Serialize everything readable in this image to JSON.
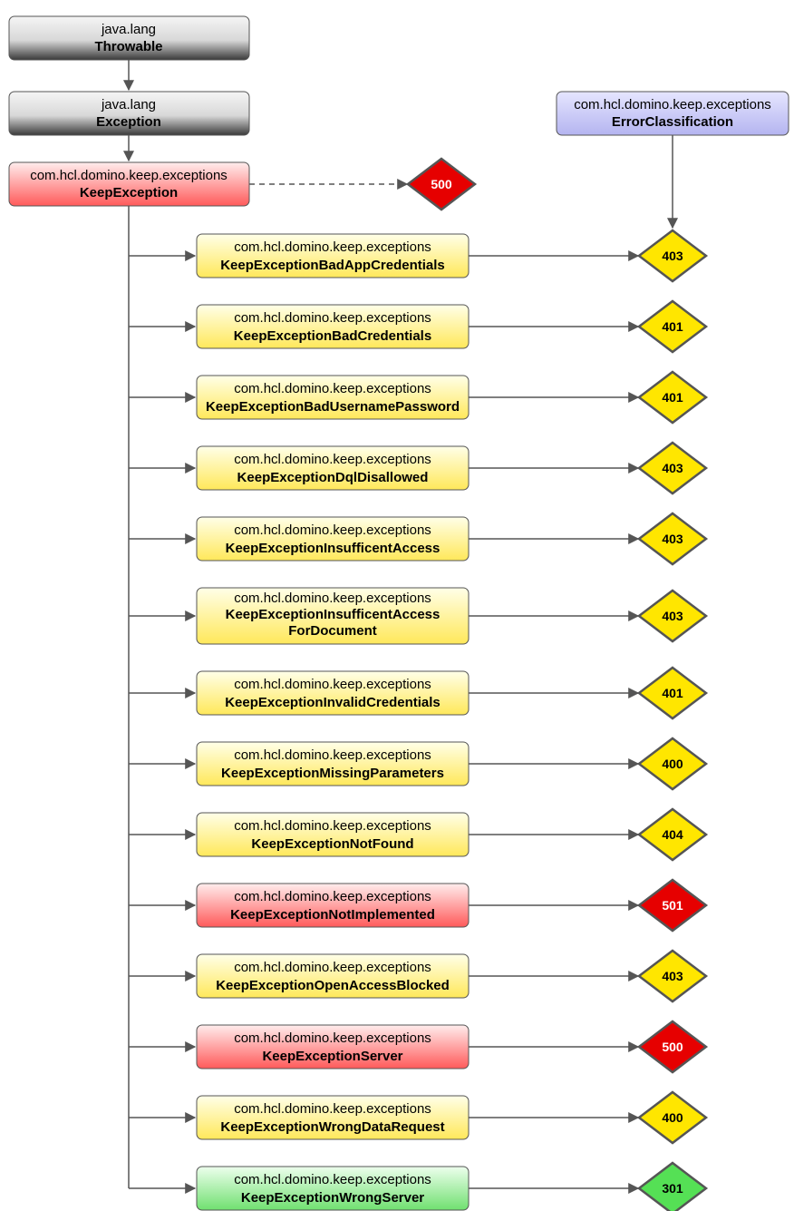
{
  "throwable": {
    "package": "java.lang",
    "name": "Throwable"
  },
  "exception": {
    "package": "java.lang",
    "name": "Exception"
  },
  "keepException": {
    "package": "com.hcl.domino.keep.exceptions",
    "name": "KeepException"
  },
  "errorClassification": {
    "package": "com.hcl.domino.keep.exceptions",
    "name": "ErrorClassification"
  },
  "keepExceptionCode": "500",
  "children": [
    {
      "package": "com.hcl.domino.keep.exceptions",
      "name": "KeepExceptionBadAppCredentials",
      "code": "403",
      "color": "yellow"
    },
    {
      "package": "com.hcl.domino.keep.exceptions",
      "name": "KeepExceptionBadCredentials",
      "code": "401",
      "color": "yellow"
    },
    {
      "package": "com.hcl.domino.keep.exceptions",
      "name": "KeepExceptionBadUsernamePassword",
      "code": "401",
      "color": "yellow"
    },
    {
      "package": "com.hcl.domino.keep.exceptions",
      "name": "KeepExceptionDqlDisallowed",
      "code": "403",
      "color": "yellow"
    },
    {
      "package": "com.hcl.domino.keep.exceptions",
      "name": "KeepExceptionInsufficentAccess",
      "code": "403",
      "color": "yellow"
    },
    {
      "package": "com.hcl.domino.keep.exceptions",
      "name": "KeepExceptionInsufficentAccess",
      "name2": "ForDocument",
      "code": "403",
      "color": "yellow",
      "tall": true
    },
    {
      "package": "com.hcl.domino.keep.exceptions",
      "name": "KeepExceptionInvalidCredentials",
      "code": "401",
      "color": "yellow"
    },
    {
      "package": "com.hcl.domino.keep.exceptions",
      "name": "KeepExceptionMissingParameters",
      "code": "400",
      "color": "yellow"
    },
    {
      "package": "com.hcl.domino.keep.exceptions",
      "name": "KeepExceptionNotFound",
      "code": "404",
      "color": "yellow"
    },
    {
      "package": "com.hcl.domino.keep.exceptions",
      "name": "KeepExceptionNotImplemented",
      "code": "501",
      "color": "red"
    },
    {
      "package": "com.hcl.domino.keep.exceptions",
      "name": "KeepExceptionOpenAccessBlocked",
      "code": "403",
      "color": "yellow"
    },
    {
      "package": "com.hcl.domino.keep.exceptions",
      "name": "KeepExceptionServer",
      "code": "500",
      "color": "red"
    },
    {
      "package": "com.hcl.domino.keep.exceptions",
      "name": "KeepExceptionWrongDataRequest",
      "code": "400",
      "color": "yellow"
    },
    {
      "package": "com.hcl.domino.keep.exceptions",
      "name": "KeepExceptionWrongServer",
      "code": "301",
      "color": "green"
    }
  ]
}
